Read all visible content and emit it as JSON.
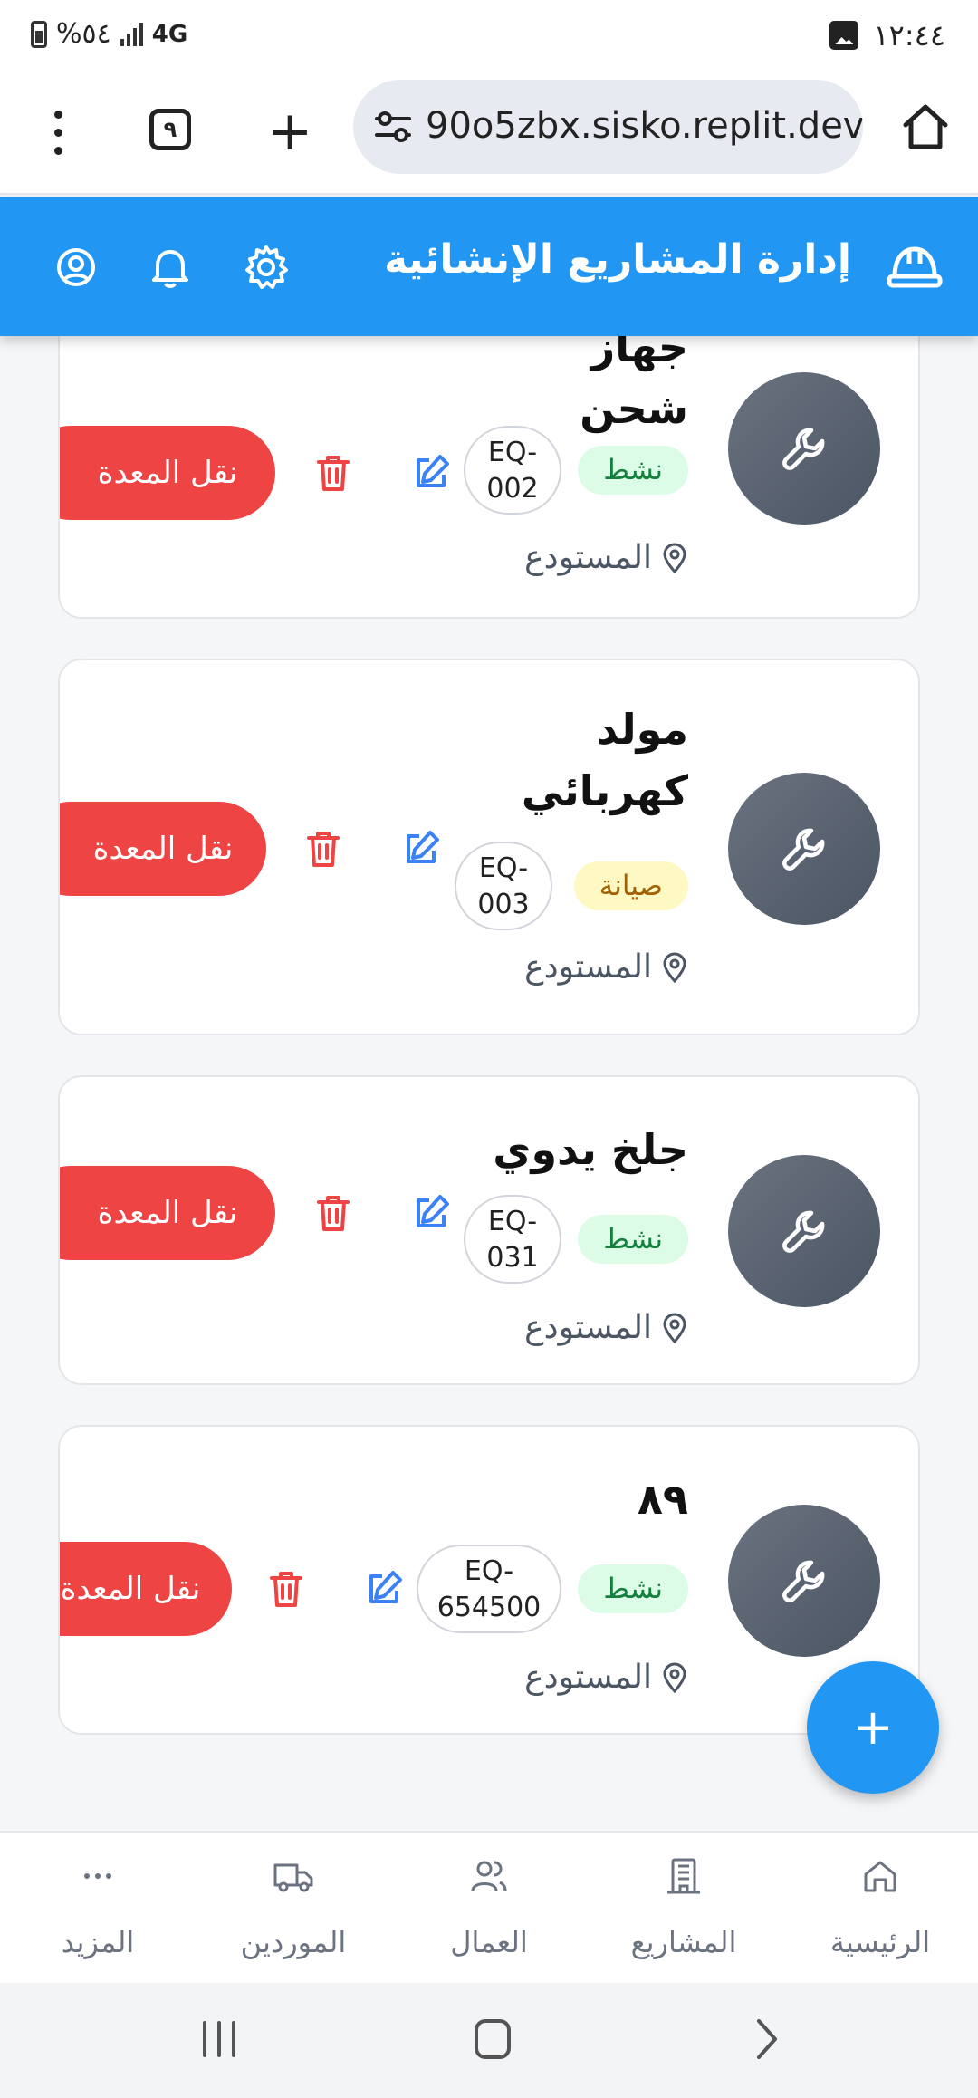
{
  "status_bar": {
    "battery": "%٥٤",
    "network": "4G",
    "time": "١٢:٤٤"
  },
  "browser": {
    "tab_count": "٩",
    "url": "90o5zbx.sisko.replit.dev"
  },
  "header": {
    "title": "إدارة المشاريع الإنشائية"
  },
  "equipment": [
    {
      "name_lines": [
        "جهاز",
        "شحن"
      ],
      "status": "نشط",
      "status_type": "active",
      "code_lines": [
        "EQ-",
        "002"
      ],
      "location": "المستودع",
      "move_label": "نقل المعدة"
    },
    {
      "name_lines": [
        "مولد",
        "كهربائي"
      ],
      "status": "صيانة",
      "status_type": "maintenance",
      "code_lines": [
        "EQ-",
        "003"
      ],
      "location": "المستودع",
      "move_label": "نقل المعدة"
    },
    {
      "name_lines": [
        "جلخ يدوي"
      ],
      "status": "نشط",
      "status_type": "active",
      "code_lines": [
        "EQ-",
        "031"
      ],
      "location": "المستودع",
      "move_label": "نقل المعدة"
    },
    {
      "name_lines": [
        "٨٩"
      ],
      "status": "نشط",
      "status_type": "active",
      "code_lines": [
        "EQ-",
        "654500"
      ],
      "location": "المستودع",
      "move_label": "نقل المعدة"
    }
  ],
  "fab": {
    "label": "+"
  },
  "bottom_nav": [
    {
      "label": "الرئيسية",
      "icon": "home-icon"
    },
    {
      "label": "المشاريع",
      "icon": "building-icon"
    },
    {
      "label": "العمال",
      "icon": "users-icon"
    },
    {
      "label": "الموردين",
      "icon": "truck-icon"
    },
    {
      "label": "المزيد",
      "icon": "more-icon"
    }
  ],
  "colors": {
    "primary": "#2196f3",
    "danger": "#ef4444",
    "active_bg": "#dcfce7",
    "active_text": "#15803d",
    "maintenance_bg": "#fef9c3",
    "maintenance_text": "#a16207"
  }
}
